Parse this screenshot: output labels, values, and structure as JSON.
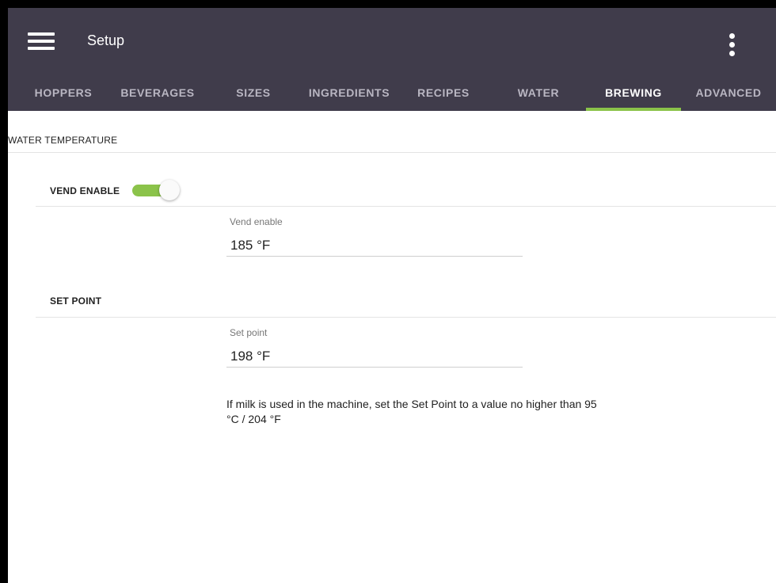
{
  "app": {
    "title": "Setup"
  },
  "tabs": [
    {
      "label": "HOPPERS",
      "active": false
    },
    {
      "label": "BEVERAGES",
      "active": false
    },
    {
      "label": "SIZES",
      "active": false
    },
    {
      "label": "INGREDIENTS",
      "active": false
    },
    {
      "label": "RECIPES",
      "active": false
    },
    {
      "label": "WATER",
      "active": false
    },
    {
      "label": "BREWING",
      "active": true
    },
    {
      "label": "ADVANCED",
      "active": false
    }
  ],
  "section": {
    "title": "WATER TEMPERATURE"
  },
  "vend_enable": {
    "label": "VEND ENABLE",
    "toggle_on": true,
    "field_label": "Vend enable",
    "value": "185 °F"
  },
  "set_point": {
    "label": "SET POINT",
    "field_label": "Set point",
    "value": "198 °F"
  },
  "note": "If milk is used in the machine, set the Set Point to a value no higher than 95 °C / 204 °F",
  "colors": {
    "appbar": "#403c4b",
    "accent": "#8bc34a",
    "tab_inactive": "#b9b6c2",
    "tab_active": "#ffffff"
  },
  "icons": {
    "menu": "hamburger-menu-icon",
    "overflow": "more-vertical-icon"
  }
}
